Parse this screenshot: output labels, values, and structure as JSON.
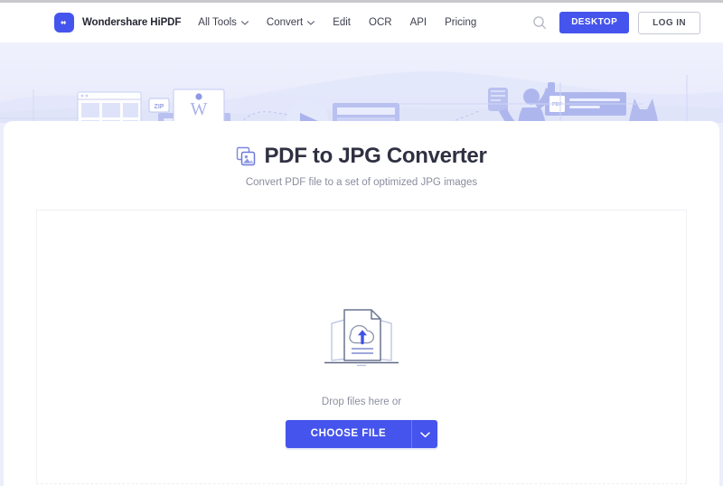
{
  "colors": {
    "brand_blue": "#4554ec",
    "page_bg": "#eceefb",
    "card_bg": "#ffffff",
    "title_text": "#2f3142",
    "muted_text": "#8a8c9e",
    "banner_accent": "#b9c0f3"
  },
  "navbar": {
    "logo_icon": "wondershare-logo-icon",
    "brand_name": "Wondershare HiPDF",
    "items": [
      {
        "label": "All Tools",
        "has_caret": true
      },
      {
        "label": "Convert",
        "has_caret": true
      },
      {
        "label": "Edit",
        "has_caret": false
      },
      {
        "label": "OCR",
        "has_caret": false
      },
      {
        "label": "API",
        "has_caret": false
      },
      {
        "label": "Pricing",
        "has_caret": false
      }
    ],
    "search_icon": "search-icon",
    "desktop_label": "DESKTOP",
    "login_label": "LOG IN"
  },
  "hero": {
    "icon_name": "document-conversion-banner-illustration"
  },
  "main": {
    "title_icon": "pdf-to-jpg-image-icon",
    "title": "PDF to JPG Converter",
    "subtitle": "Convert PDF file to a set of optimized JPG images",
    "dropzone": {
      "upload_icon": "cloud-upload-documents-icon",
      "drop_text": "Drop files here or",
      "choose_file_label": "CHOOSE FILE",
      "choose_caret_icon": "chevron-down-icon"
    }
  }
}
